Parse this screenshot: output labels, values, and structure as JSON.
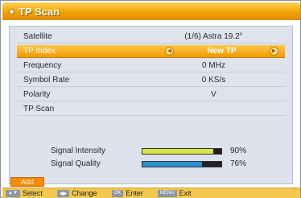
{
  "title": "TP Scan",
  "rows": [
    {
      "label": "Satellite",
      "value": "(1/6) Astra 19.2°"
    },
    {
      "label": "TP Index",
      "value": "New TP"
    },
    {
      "label": "Frequency",
      "value": "0 MHz"
    },
    {
      "label": "Symbol Rate",
      "value": "0 KS/s"
    },
    {
      "label": "Polarity",
      "value": "V"
    },
    {
      "label": "TP Scan",
      "value": ""
    }
  ],
  "signal": {
    "intensity_label": "Signal Intensity",
    "intensity_value": "90%",
    "intensity_fraction": 0.9,
    "quality_label": "Signal Quality",
    "quality_value": "76%",
    "quality_fraction": 0.76
  },
  "add_label": "Add",
  "footer": {
    "select_key": "▲▼",
    "select_label": "Select",
    "change_key": "◀▶",
    "change_label": "Change",
    "ok_key": "OK",
    "ok_label": "Enter",
    "menu_key": "MENU",
    "menu_label": "Exit"
  },
  "colors": {
    "accent": "#f0a400",
    "intensity_bar": "#d8e64a",
    "quality_bar": "#2a8fd0"
  }
}
